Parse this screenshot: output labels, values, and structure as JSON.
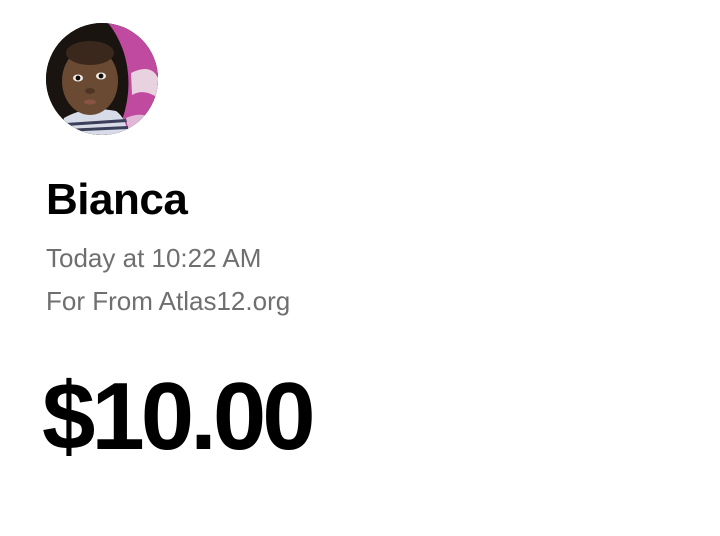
{
  "payment": {
    "sender_name": "Bianca",
    "timestamp": "Today at 10:22 AM",
    "note": "For From Atlas12.org",
    "amount": "$10.00"
  },
  "avatar": {
    "icon": "profile-photo",
    "description_colors": {
      "background": "#1a1410",
      "blanket": "#c04aa0",
      "skin": "#6b4a34"
    }
  },
  "colors": {
    "primary_text": "#000000",
    "secondary_text": "#6f6f6f",
    "background": "#ffffff"
  }
}
